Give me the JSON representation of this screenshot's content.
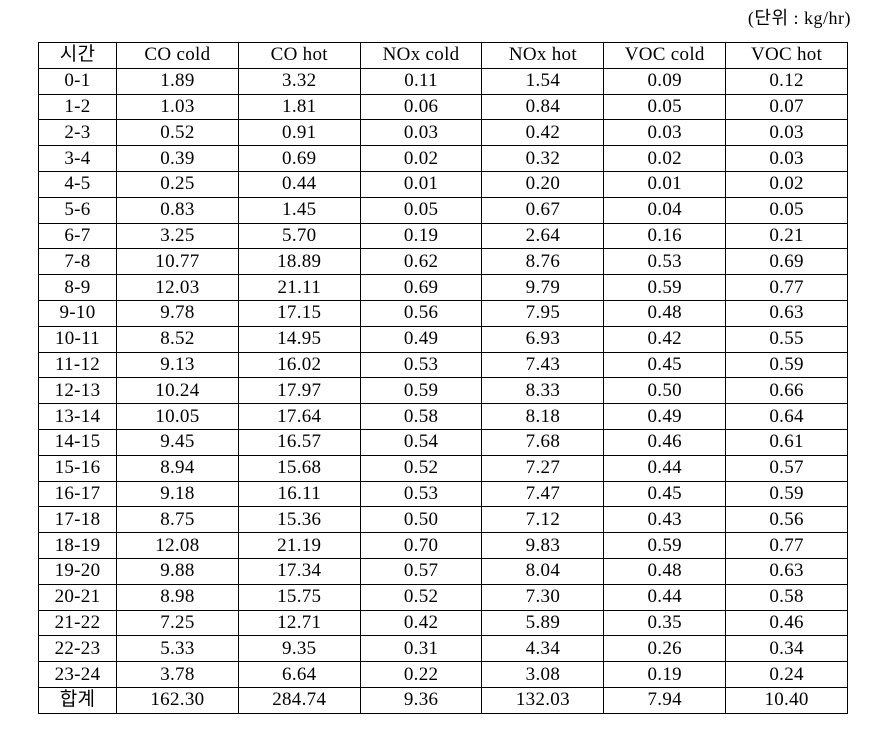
{
  "unit_label": "(단위 : kg/hr)",
  "table": {
    "headers": [
      "시간",
      "CO cold",
      "CO hot",
      "NOx cold",
      "NOx hot",
      "VOC cold",
      "VOC hot"
    ],
    "rows": [
      [
        "0-1",
        "1.89",
        "3.32",
        "0.11",
        "1.54",
        "0.09",
        "0.12"
      ],
      [
        "1-2",
        "1.03",
        "1.81",
        "0.06",
        "0.84",
        "0.05",
        "0.07"
      ],
      [
        "2-3",
        "0.52",
        "0.91",
        "0.03",
        "0.42",
        "0.03",
        "0.03"
      ],
      [
        "3-4",
        "0.39",
        "0.69",
        "0.02",
        "0.32",
        "0.02",
        "0.03"
      ],
      [
        "4-5",
        "0.25",
        "0.44",
        "0.01",
        "0.20",
        "0.01",
        "0.02"
      ],
      [
        "5-6",
        "0.83",
        "1.45",
        "0.05",
        "0.67",
        "0.04",
        "0.05"
      ],
      [
        "6-7",
        "3.25",
        "5.70",
        "0.19",
        "2.64",
        "0.16",
        "0.21"
      ],
      [
        "7-8",
        "10.77",
        "18.89",
        "0.62",
        "8.76",
        "0.53",
        "0.69"
      ],
      [
        "8-9",
        "12.03",
        "21.11",
        "0.69",
        "9.79",
        "0.59",
        "0.77"
      ],
      [
        "9-10",
        "9.78",
        "17.15",
        "0.56",
        "7.95",
        "0.48",
        "0.63"
      ],
      [
        "10-11",
        "8.52",
        "14.95",
        "0.49",
        "6.93",
        "0.42",
        "0.55"
      ],
      [
        "11-12",
        "9.13",
        "16.02",
        "0.53",
        "7.43",
        "0.45",
        "0.59"
      ],
      [
        "12-13",
        "10.24",
        "17.97",
        "0.59",
        "8.33",
        "0.50",
        "0.66"
      ],
      [
        "13-14",
        "10.05",
        "17.64",
        "0.58",
        "8.18",
        "0.49",
        "0.64"
      ],
      [
        "14-15",
        "9.45",
        "16.57",
        "0.54",
        "7.68",
        "0.46",
        "0.61"
      ],
      [
        "15-16",
        "8.94",
        "15.68",
        "0.52",
        "7.27",
        "0.44",
        "0.57"
      ],
      [
        "16-17",
        "9.18",
        "16.11",
        "0.53",
        "7.47",
        "0.45",
        "0.59"
      ],
      [
        "17-18",
        "8.75",
        "15.36",
        "0.50",
        "7.12",
        "0.43",
        "0.56"
      ],
      [
        "18-19",
        "12.08",
        "21.19",
        "0.70",
        "9.83",
        "0.59",
        "0.77"
      ],
      [
        "19-20",
        "9.88",
        "17.34",
        "0.57",
        "8.04",
        "0.48",
        "0.63"
      ],
      [
        "20-21",
        "8.98",
        "15.75",
        "0.52",
        "7.30",
        "0.44",
        "0.58"
      ],
      [
        "21-22",
        "7.25",
        "12.71",
        "0.42",
        "5.89",
        "0.35",
        "0.46"
      ],
      [
        "22-23",
        "5.33",
        "9.35",
        "0.31",
        "4.34",
        "0.26",
        "0.34"
      ],
      [
        "23-24",
        "3.78",
        "6.64",
        "0.22",
        "3.08",
        "0.19",
        "0.24"
      ]
    ],
    "total": [
      "합계",
      "162.30",
      "284.74",
      "9.36",
      "132.03",
      "7.94",
      "10.40"
    ]
  }
}
